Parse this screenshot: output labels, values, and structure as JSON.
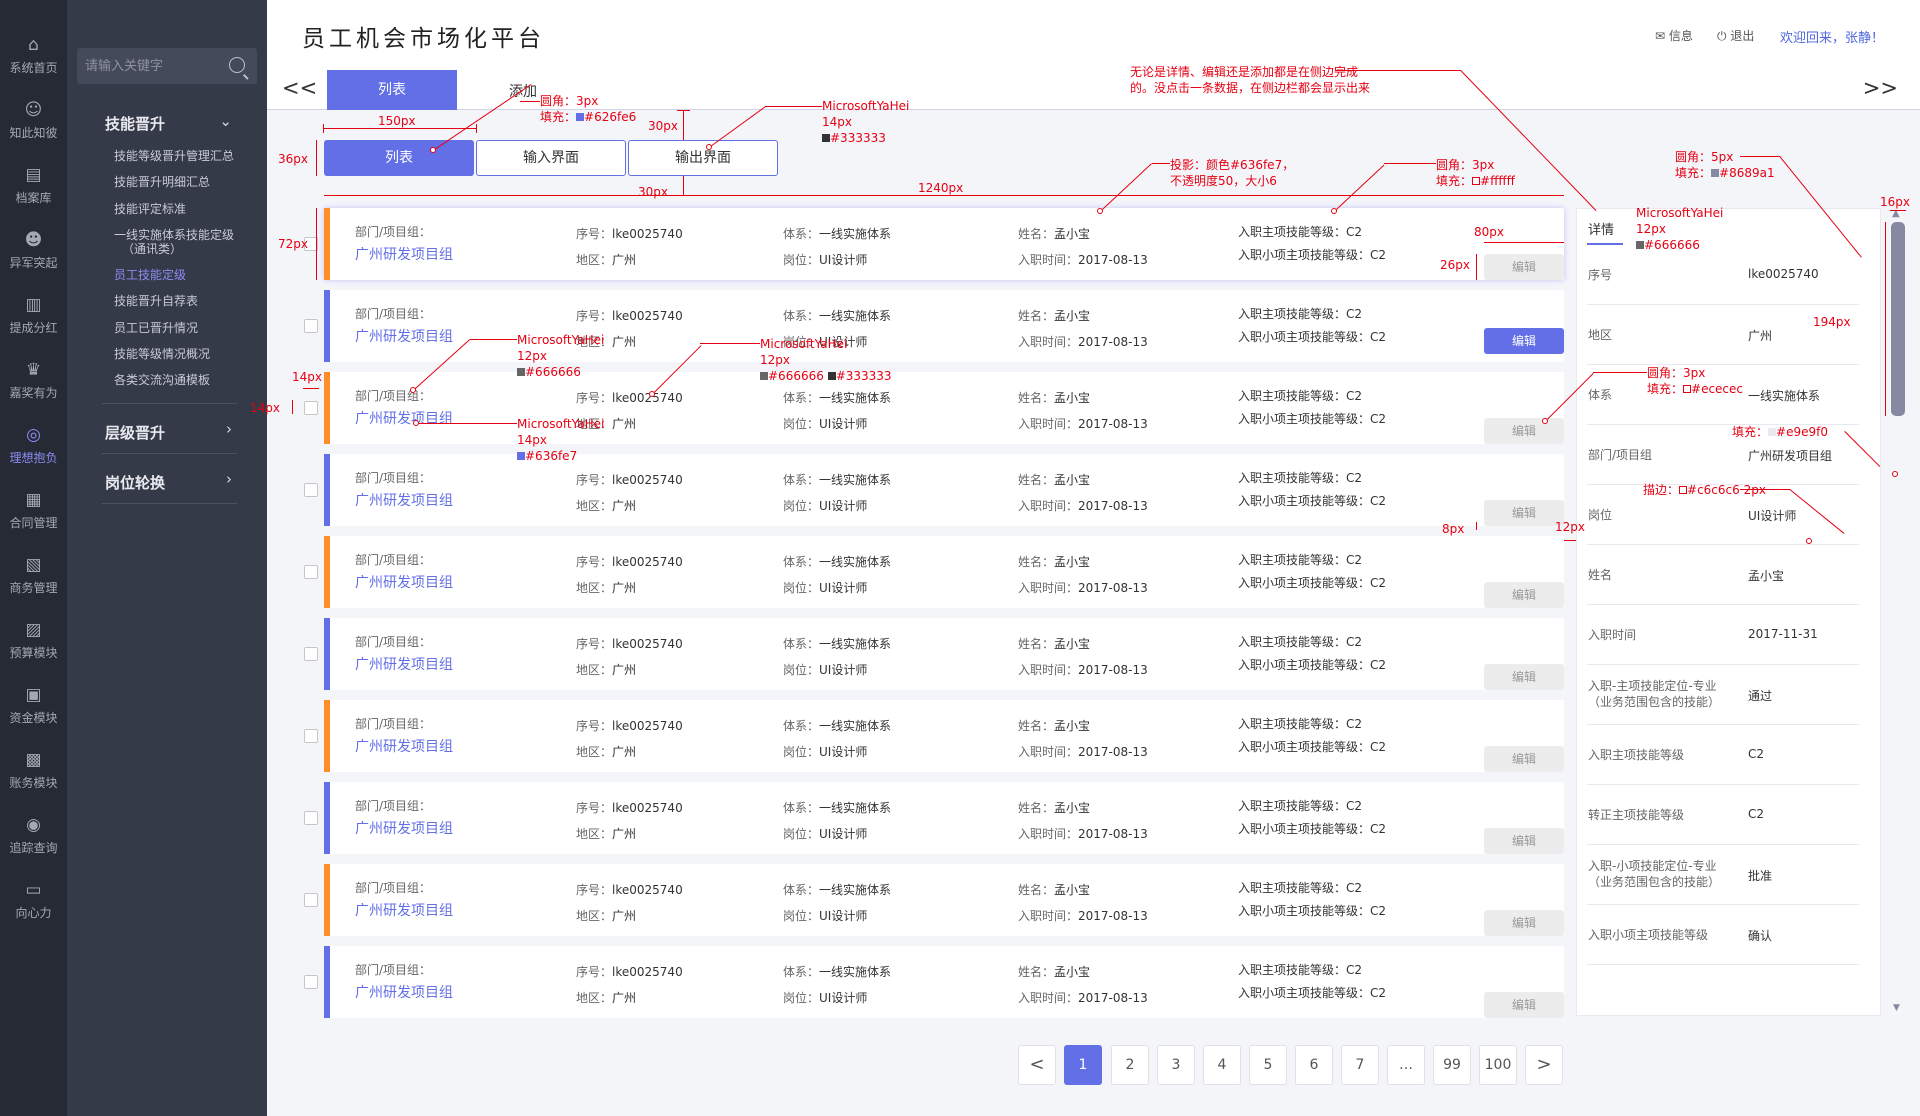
{
  "nav": {
    "items": [
      {
        "label": "系统首页",
        "icon": "home-icon"
      },
      {
        "label": "知此知彼",
        "icon": "people-icon"
      },
      {
        "label": "档案库",
        "icon": "archive-icon"
      },
      {
        "label": "异军突起",
        "icon": "user-icon"
      },
      {
        "label": "提成分红",
        "icon": "dividend-icon"
      },
      {
        "label": "嘉奖有为",
        "icon": "trophy-icon"
      },
      {
        "label": "理想抱负",
        "icon": "lightbulb-icon"
      },
      {
        "label": "合同管理",
        "icon": "contract-icon"
      },
      {
        "label": "商务管理",
        "icon": "business-icon"
      },
      {
        "label": "预算模块",
        "icon": "budget-icon"
      },
      {
        "label": "资金模块",
        "icon": "funds-icon"
      },
      {
        "label": "账务模块",
        "icon": "accounts-icon"
      },
      {
        "label": "追踪查询",
        "icon": "tracking-icon"
      },
      {
        "label": "向心力",
        "icon": "chat-icon"
      }
    ],
    "active_index": 6
  },
  "submenu": {
    "search_placeholder": "请输入关键字",
    "group1_title": "技能晋升",
    "group1_items": [
      "技能等级晋升管理汇总",
      "技能晋升明细汇总",
      "技能评定标准",
      "一线实施体系技能定级",
      "（通讯类）",
      "员工技能定级",
      "技能晋升自荐表",
      "员工已晋升情况",
      "技能等级情况概况",
      "各类交流沟通模板"
    ],
    "active_item_index": 5,
    "group2_title": "层级晋升",
    "group3_title": "岗位轮换"
  },
  "header": {
    "title": "员工机会市场化平台",
    "msg": "信息",
    "exit": "退出",
    "welcome": "欢迎回来，张静！"
  },
  "tabs": {
    "prev": "<<",
    "next": ">>",
    "list": "列表",
    "add": "添加"
  },
  "view_buttons": {
    "list": "列表",
    "input": "输入界面",
    "output": "输出界面"
  },
  "records": {
    "dept_label": "部门/项目组：",
    "dept": "广州研发项目组",
    "no_label": "序号：",
    "no": "lke0025740",
    "area_label": "地区：",
    "area": "广州",
    "system_label": "体系：",
    "system": "一线实施体系",
    "post_label": "岗位：",
    "post": "UI设计师",
    "name_label": "姓名：",
    "name": "孟小宝",
    "date_label": "入职时间：",
    "date": "2017-08-13",
    "main_skill": "入职主项技能等级：C2",
    "minor_skill": "入职小项主项技能等级：C2",
    "edit": "编辑",
    "bar_colors": [
      "#ff8d28",
      "#626fe6",
      "#ff8d28",
      "#626fe6",
      "#ff8d28",
      "#626fe6",
      "#ff8d28",
      "#626fe6",
      "#ff8d28",
      "#626fe6"
    ],
    "primary_edit_index": 1,
    "selected_index": 0
  },
  "detail": {
    "tab": "详情",
    "rows": [
      {
        "label": "序号",
        "value": "lke0025740"
      },
      {
        "label": "地区",
        "value": "广州"
      },
      {
        "label": "体系",
        "value": "一线实施体系"
      },
      {
        "label": "部门/项目组",
        "value": "广州研发项目组"
      },
      {
        "label": "岗位",
        "value": "UI设计师"
      },
      {
        "label": "姓名",
        "value": "孟小宝"
      },
      {
        "label": "入职时间",
        "value": "2017-11-31"
      },
      {
        "label": "入职-主项技能定位-专业",
        "label2": "（业务范围包含的技能）",
        "value": "通过"
      },
      {
        "label": "入职主项技能等级",
        "value": "C2"
      },
      {
        "label": "转正主项技能等级",
        "value": "C2"
      },
      {
        "label": "入职-小项技能定位-专业",
        "label2": "（业务范围包含的技能）",
        "value": "批准"
      },
      {
        "label": "入职小项主项技能等级",
        "value": "确认"
      }
    ]
  },
  "pagination": {
    "prev": "<",
    "pages": [
      "1",
      "2",
      "3",
      "4",
      "5",
      "6",
      "7",
      "…",
      "99",
      "100"
    ],
    "next": ">",
    "active": "1"
  },
  "annotations": {
    "a_tip1": "无论是详情、编辑还是添加都是在侧边完成",
    "a_tip2": "的。没点击一条数据，在侧边栏都会显示出来",
    "a_radius3": "圆角：3px",
    "a_fill_626": "填充：",
    "a_hex_626": "#626fe6",
    "a_150": "150px",
    "a_30": "30px",
    "a_font_yahei": "MicrosoftYaHei",
    "a_14": "14px",
    "a_hex_333": "#333333",
    "a_36": "36px",
    "a_30b": "30px",
    "a_1240": "1240px",
    "a_shadow1": "投影：颜色#636fe7，",
    "a_shadow2": "不透明度50，大小6",
    "a_radius3b": "圆角：3px",
    "a_fill_fff": "填充：",
    "a_hex_fff": "#ffffff",
    "a_72": "72px",
    "a_80": "80px",
    "a_26": "26px",
    "a_font2": "MicrosoftYaHei",
    "a_12": "12px",
    "a_hex_666": "#666666",
    "a_font3": "MicrosoftYaHei",
    "a_12b": "12px",
    "a_hex_666b": "#666666",
    "a_hex_333b": "#333333",
    "a_font4": "MicrosoftYaHei",
    "a_14b": "14px",
    "a_hex_636": "#636fe7",
    "a_14px_l": "14px",
    "a_14px_m": "14px",
    "a_radius5": "圆角：5px",
    "a_fill_868": "填充：",
    "a_hex_868": "#8689a1",
    "a_16": "16px",
    "a_font5": "MicrosoftYaHei",
    "a_12c": "12px",
    "a_hex_666c": "#666666",
    "a_194": "194px",
    "a_radius3c": "圆角：3px",
    "a_fill_ece": "填充：",
    "a_hex_ece": "#ececec",
    "a_fill_e9e": "填充：",
    "a_hex_e9e": "#e9e9f0",
    "a_stroke": "描边：",
    "a_hex_c6c": "#c6c6c6 2px",
    "a_8": "8px",
    "a_12px": "12px",
    "sw_626": "#626fe6",
    "sw_333": "#333333",
    "sw_fff": "#ffffff",
    "sw_666": "#666666",
    "sw_636": "#636fe7",
    "sw_868": "#8689a1",
    "sw_ece": "#ececec",
    "sw_e9e": "#e9e9f0",
    "sw_c6c": "#c6c6c6"
  }
}
